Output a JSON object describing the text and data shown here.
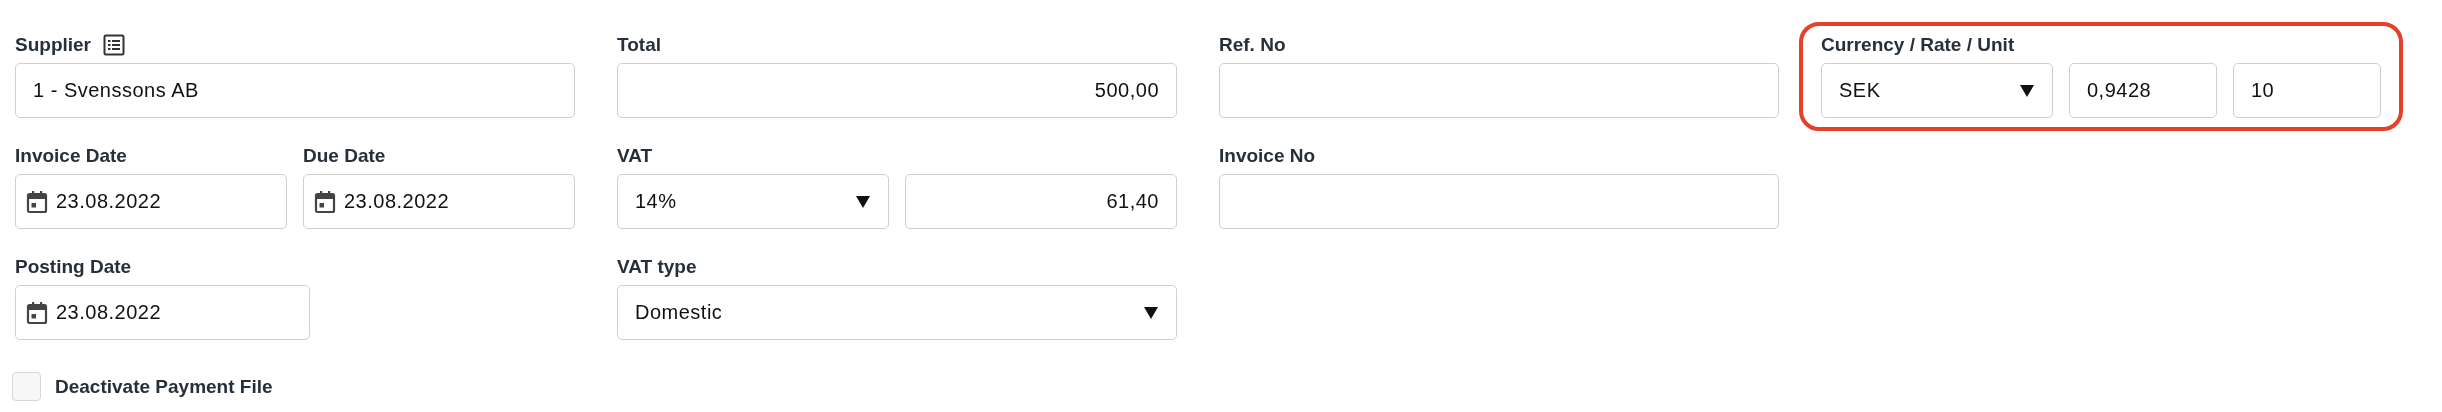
{
  "columns": [
    {
      "highlighted": false,
      "rows": [
        {
          "cells": [
            {
              "label": "Supplier",
              "lookup": true,
              "fields": [
                {
                  "kind": "text",
                  "value": "1 - Svenssons AB"
                }
              ]
            }
          ]
        },
        {
          "cells": [
            {
              "label": "Invoice Date",
              "fields": [
                {
                  "kind": "date",
                  "value": "23.08.2022"
                }
              ]
            },
            {
              "label": "Due Date",
              "fields": [
                {
                  "kind": "date",
                  "value": "23.08.2022"
                }
              ]
            }
          ]
        },
        {
          "cells": [
            {
              "label": "Posting Date",
              "fields": [
                {
                  "kind": "date",
                  "value": "23.08.2022"
                }
              ]
            }
          ]
        }
      ]
    },
    {
      "highlighted": false,
      "rows": [
        {
          "cells": [
            {
              "label": "Total",
              "fields": [
                {
                  "kind": "amount",
                  "value": "500,00"
                }
              ]
            }
          ]
        },
        {
          "cells": [
            {
              "label": "VAT",
              "fields": [
                {
                  "kind": "select",
                  "value": "14%"
                },
                {
                  "kind": "amount",
                  "value": "61,40"
                }
              ]
            }
          ]
        },
        {
          "cells": [
            {
              "label": "VAT type",
              "fields": [
                {
                  "kind": "select",
                  "value": "Domestic"
                }
              ]
            }
          ]
        }
      ]
    },
    {
      "highlighted": false,
      "rows": [
        {
          "cells": [
            {
              "label": "Ref. No",
              "fields": [
                {
                  "kind": "text"
                }
              ]
            }
          ]
        },
        {
          "cells": [
            {
              "label": "Invoice No",
              "fields": [
                {
                  "kind": "text"
                }
              ]
            }
          ]
        }
      ]
    },
    {
      "highlighted": true,
      "rows": [
        {
          "cells": [
            {
              "label": "Currency / Rate / Unit",
              "fields": [
                {
                  "kind": "select",
                  "value": "SEK"
                },
                {
                  "kind": "text",
                  "value": "0,9428"
                },
                {
                  "kind": "text",
                  "value": "10"
                }
              ]
            }
          ]
        }
      ]
    }
  ],
  "checkbox": {
    "label": "Deactivate Payment File",
    "checked": false
  }
}
